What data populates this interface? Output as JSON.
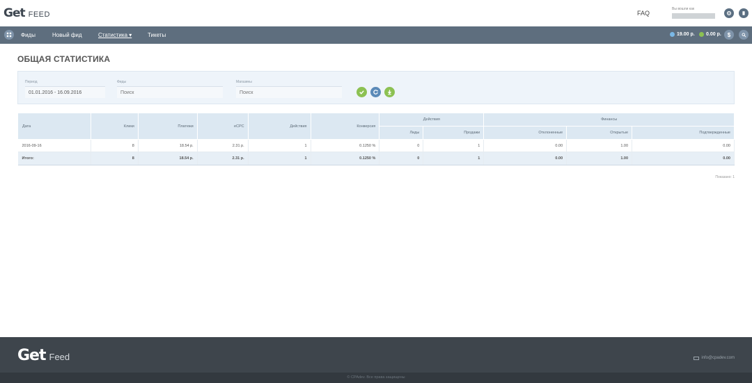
{
  "header": {
    "logo_get": "Get",
    "logo_feed": "FEED",
    "faq": "FAQ",
    "user_label": "Вы вошли как"
  },
  "nav": {
    "items": [
      {
        "label": "Фиды"
      },
      {
        "label": "Новый фид"
      },
      {
        "label": "Статистика ▾"
      },
      {
        "label": "Тикеты"
      }
    ],
    "balance_1": "19.00 р.",
    "balance_2": "0.00 р.",
    "dollar": "$"
  },
  "page": {
    "title": "ОБЩАЯ СТАТИСТИКА"
  },
  "filters": {
    "period_label": "Период",
    "period_value": "01.01.2016 - 16.09.2016",
    "feeds_label": "Фиды",
    "feeds_placeholder": "Поиск",
    "shops_label": "Магазины",
    "shops_placeholder": "Поиск"
  },
  "table": {
    "headers": {
      "date": "Дата",
      "clicks": "Клики",
      "payments": "Платежи",
      "ecpc": "eCPC",
      "actions": "Действия",
      "conversion": "Конверсия",
      "actions_group": "Действия",
      "leads": "Лиды",
      "sales": "Продажи",
      "finance_group": "Финансы",
      "rejected": "Отклоненные",
      "open": "Открытые",
      "confirmed": "Подтвержденные"
    },
    "row": {
      "date": "2016-09-16",
      "clicks": "8",
      "payments": "18.54 р.",
      "ecpc": "2.31 р.",
      "actions": "1",
      "conversion": "0.1250 %",
      "leads": "0",
      "sales": "1",
      "rejected": "0.00",
      "open": "1.00",
      "confirmed": "0.00"
    },
    "total": {
      "label": "Итого:",
      "clicks": "8",
      "payments": "18.54 р.",
      "ecpc": "2.31 р.",
      "actions": "1",
      "conversion": "0.1250 %",
      "leads": "0",
      "sales": "1",
      "rejected": "0.00",
      "open": "1.00",
      "confirmed": "0.00"
    },
    "shown": "Показано: 1"
  },
  "footer": {
    "logo_get": "Get",
    "logo_feed": "Feed",
    "email": "info@cpadev.com",
    "copyright": "© CPAdev. Все права защищены"
  },
  "colors": {
    "navbar": "#5e6e7e",
    "accent_green": "#8cc152",
    "accent_blue": "#5b8ab8",
    "footer": "#3e454c"
  }
}
